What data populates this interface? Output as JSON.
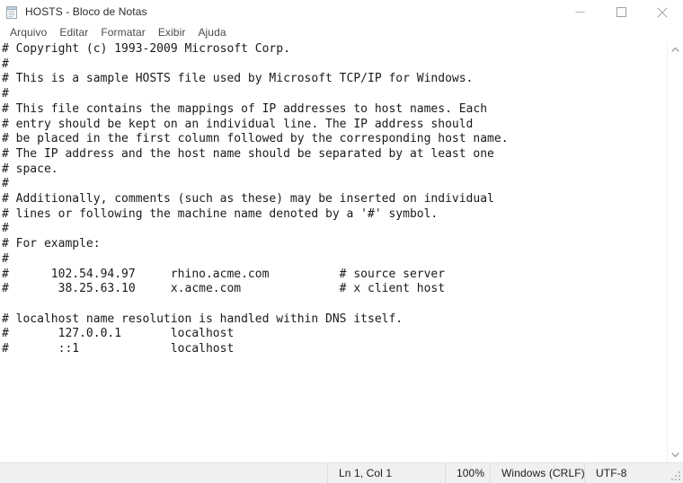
{
  "window": {
    "title": "HOSTS - Bloco de Notas",
    "icon": "notepad-icon",
    "controls": {
      "minimize_label": "Minimizar",
      "maximize_label": "Maximizar",
      "close_label": "Fechar"
    }
  },
  "menu": {
    "items": [
      {
        "label": "Arquivo"
      },
      {
        "label": "Editar"
      },
      {
        "label": "Formatar"
      },
      {
        "label": "Exibir"
      },
      {
        "label": "Ajuda"
      }
    ]
  },
  "editor": {
    "text": "# Copyright (c) 1993-2009 Microsoft Corp.\n#\n# This is a sample HOSTS file used by Microsoft TCP/IP for Windows.\n#\n# This file contains the mappings of IP addresses to host names. Each\n# entry should be kept on an individual line. The IP address should\n# be placed in the first column followed by the corresponding host name.\n# The IP address and the host name should be separated by at least one\n# space.\n#\n# Additionally, comments (such as these) may be inserted on individual\n# lines or following the machine name denoted by a '#' symbol.\n#\n# For example:\n#\n#      102.54.94.97     rhino.acme.com          # source server\n#       38.25.63.10     x.acme.com              # x client host\n\n# localhost name resolution is handled within DNS itself.\n#       127.0.0.1       localhost\n#       ::1             localhost"
  },
  "scrollbar": {
    "up_arrow": "chevron-up-icon",
    "down_arrow": "chevron-down-icon"
  },
  "status_bar": {
    "cursor_position": "Ln 1, Col 1",
    "zoom_level": "100%",
    "line_ending": "Windows (CRLF)",
    "encoding": "UTF-8"
  },
  "colors": {
    "window_background": "#ffffff",
    "status_background": "#f0f0f0",
    "text_color": "#1a1a1a",
    "menu_text": "#4a4a4a"
  }
}
